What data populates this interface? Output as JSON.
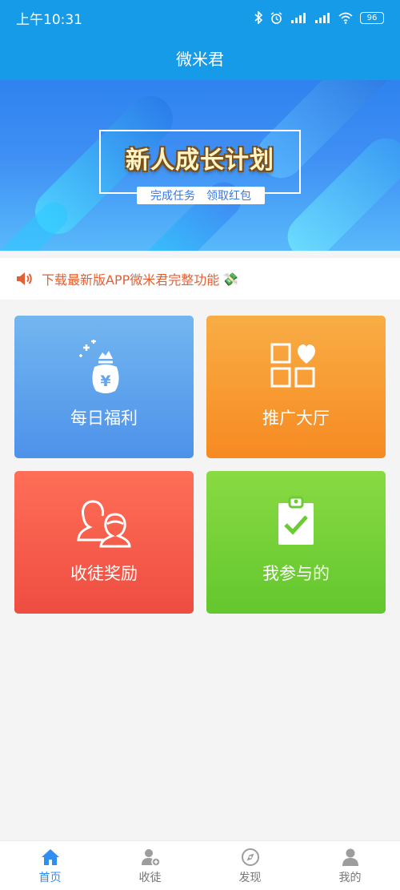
{
  "status_bar": {
    "time": "上午10:31",
    "battery": "96"
  },
  "app": {
    "title": "微米君"
  },
  "banner": {
    "title": "新人成长计划",
    "tagline": "完成任务　领取红包"
  },
  "notice": {
    "text": "下载最新版APP微米君完整功能"
  },
  "cards": [
    {
      "label": "每日福利",
      "icon": "money-bag-icon",
      "color": "#5b9fed"
    },
    {
      "label": "推广大厅",
      "icon": "grid-heart-icon",
      "color": "#f79a2f"
    },
    {
      "label": "收徒奖励",
      "icon": "users-icon",
      "color": "#f05a48"
    },
    {
      "label": "我参与的",
      "icon": "clipboard-check-icon",
      "color": "#73d034"
    }
  ],
  "tabs": [
    {
      "label": "首页",
      "icon": "home-icon",
      "active": true
    },
    {
      "label": "收徒",
      "icon": "add-user-icon",
      "active": false
    },
    {
      "label": "发现",
      "icon": "compass-icon",
      "active": false
    },
    {
      "label": "我的",
      "icon": "profile-icon",
      "active": false
    }
  ],
  "colors": {
    "primary": "#159be8",
    "notice_text": "#e35f34",
    "tab_active": "#2f8ef0",
    "tab_inactive": "#777777"
  }
}
